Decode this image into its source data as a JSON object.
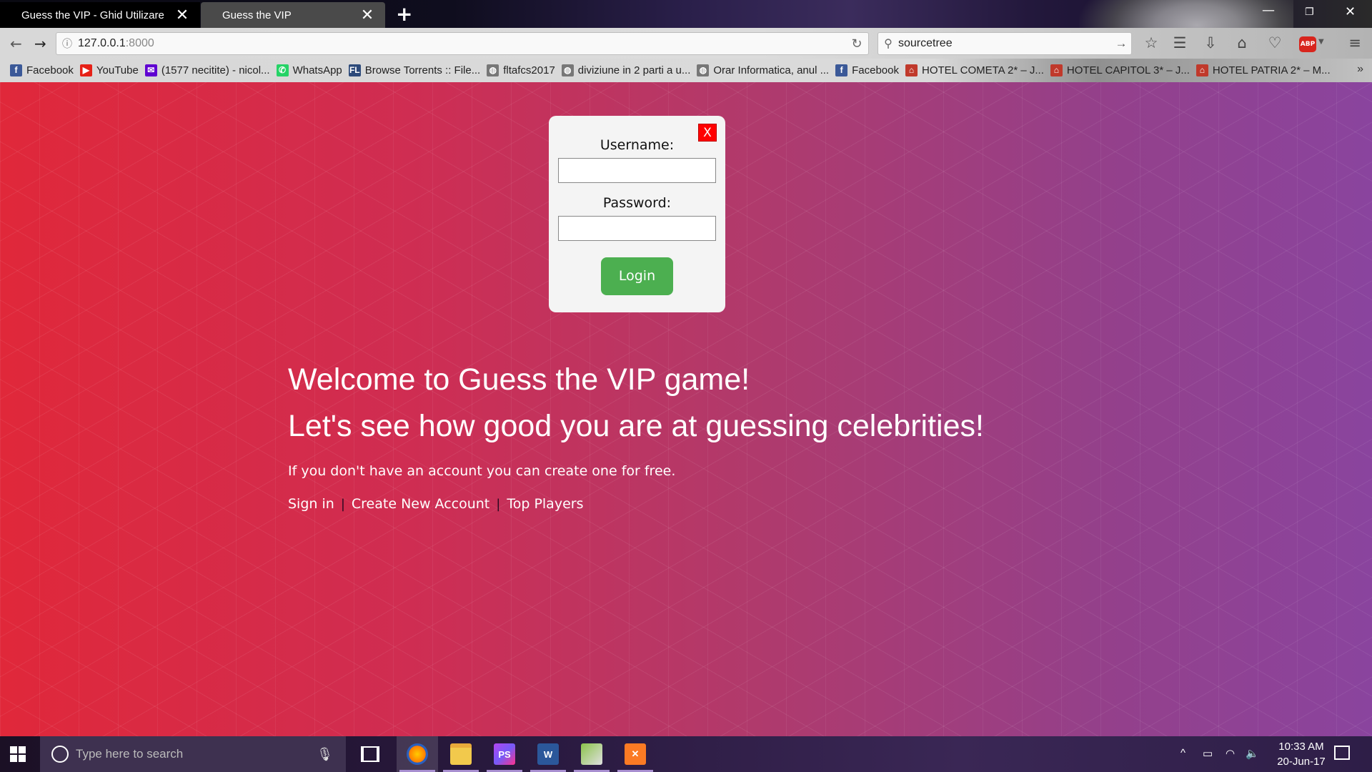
{
  "browser": {
    "tabs": [
      {
        "label": "Guess the VIP - Ghid Utilizare",
        "active": false
      },
      {
        "label": "Guess the VIP",
        "active": true
      }
    ],
    "url_host": "127.0.0.1",
    "url_port": ":8000",
    "search_value": "sourcetree",
    "bookmarks": [
      {
        "label": "Facebook",
        "icon": "facebook-icon",
        "color": "#3b5998"
      },
      {
        "label": "YouTube",
        "icon": "youtube-icon",
        "color": "#e62117"
      },
      {
        "label": "(1577 necitite) - nicol...",
        "icon": "yahoo-mail-icon",
        "color": "#5f01d1"
      },
      {
        "label": "WhatsApp",
        "icon": "whatsapp-icon",
        "color": "#25d366"
      },
      {
        "label": "Browse Torrents :: File...",
        "icon": "filelist-icon",
        "color": "#2d4a7a"
      },
      {
        "label": "fltafcs2017",
        "icon": "globe-icon",
        "color": "#777777"
      },
      {
        "label": "diviziune in 2 parti a u...",
        "icon": "globe-icon",
        "color": "#777777"
      },
      {
        "label": "Orar Informatica, anul ...",
        "icon": "globe-icon",
        "color": "#777777"
      },
      {
        "label": "Facebook",
        "icon": "facebook-icon",
        "color": "#3b5998"
      },
      {
        "label": "HOTEL COMETA 2* – J...",
        "icon": "hotel-icon",
        "color": "#c0392b"
      },
      {
        "label": "HOTEL CAPITOL 3* – J...",
        "icon": "hotel-icon",
        "color": "#c0392b"
      },
      {
        "label": "HOTEL PATRIA 2* – M...",
        "icon": "hotel-icon",
        "color": "#c0392b"
      }
    ]
  },
  "login": {
    "close_label": "X",
    "username_label": "Username:",
    "password_label": "Password:",
    "username_value": "",
    "password_value": "",
    "button_label": "Login"
  },
  "main": {
    "welcome_line1": "Welcome to Guess the VIP game!",
    "welcome_line2": "Let's see how good you are at guessing celebrities!",
    "subtext": "If you don't have an account you can create one for free.",
    "links": {
      "sign_in": "Sign in",
      "create_account": "Create New Account",
      "top_players": "Top Players",
      "separator": "|"
    }
  },
  "taskbar": {
    "search_placeholder": "Type here to search",
    "apps": [
      "firefox-icon",
      "file-explorer-icon",
      "phpstorm-icon",
      "word-icon",
      "notepad-icon",
      "xampp-icon"
    ],
    "time": "10:33 AM",
    "date": "20-Jun-17"
  },
  "colors": {
    "login_button": "#4caf50",
    "close_button": "#ff0000",
    "page_gradient_start": "#e0283a",
    "page_gradient_end": "#8a449e"
  }
}
